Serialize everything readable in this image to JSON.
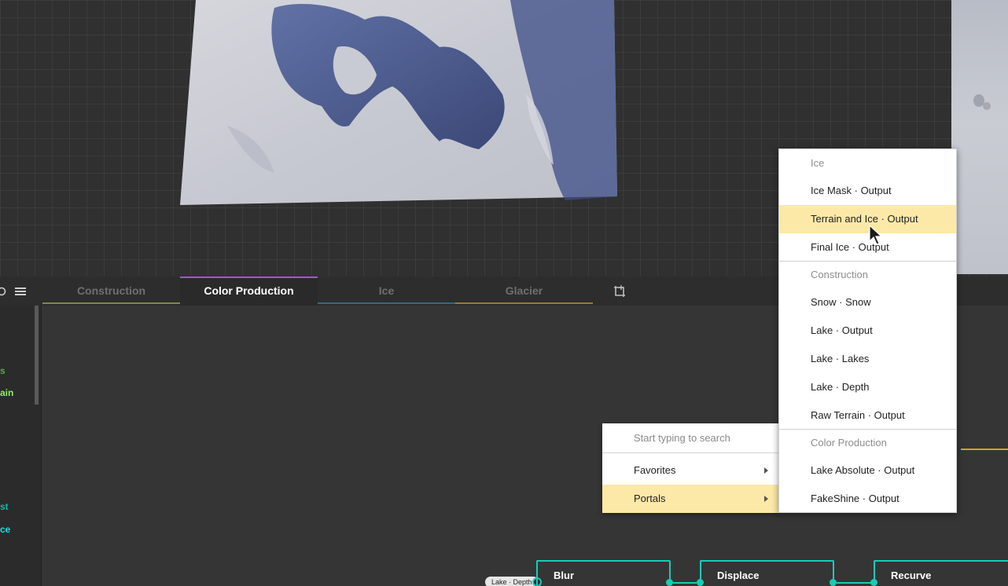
{
  "tabs": [
    {
      "label": "Construction",
      "color": "#7e8c3a",
      "active": false
    },
    {
      "label": "Color Production",
      "color": "#a855c8",
      "active": true
    },
    {
      "label": "Ice",
      "color": "#2e6a8c",
      "active": false
    },
    {
      "label": "Glacier",
      "color": "#9a7c22",
      "active": false
    }
  ],
  "sidebar": {
    "items": [
      {
        "label": "s",
        "color": "#4fae3f"
      },
      {
        "label": "ain",
        "color": "#8ff04e"
      },
      {
        "label": "st",
        "color": "#16b6a6"
      },
      {
        "label": "ce",
        "color": "#18e2e2"
      }
    ]
  },
  "context_menu": {
    "search_placeholder": "Start typing to search",
    "items": [
      {
        "label": "Favorites",
        "has_submenu": true,
        "highlighted": false
      },
      {
        "label": "Portals",
        "has_submenu": true,
        "highlighted": true
      }
    ]
  },
  "submenu": {
    "sections": [
      {
        "header": "Ice",
        "items": [
          "Ice Mask · Output",
          "Terrain and Ice · Output",
          "Final Ice · Output"
        ]
      },
      {
        "header": "Construction",
        "items": [
          "Snow · Snow",
          "Lake · Output",
          "Lake · Lakes",
          "Lake · Depth",
          "Raw Terrain · Output"
        ]
      },
      {
        "header": "Color Production",
        "items": [
          "Lake Absolute · Output",
          "FakeShine · Output"
        ]
      }
    ],
    "highlighted_item": "Terrain and Ice · Output"
  },
  "nodes": {
    "input_tag": "Lake · Depth",
    "items": [
      {
        "title": "Blur"
      },
      {
        "title": "Displace"
      },
      {
        "title": "Recurve"
      }
    ]
  },
  "colors": {
    "node_accent": "#16cdb8",
    "highlight": "#fde9a7",
    "wire_orange": "#d8a020"
  }
}
